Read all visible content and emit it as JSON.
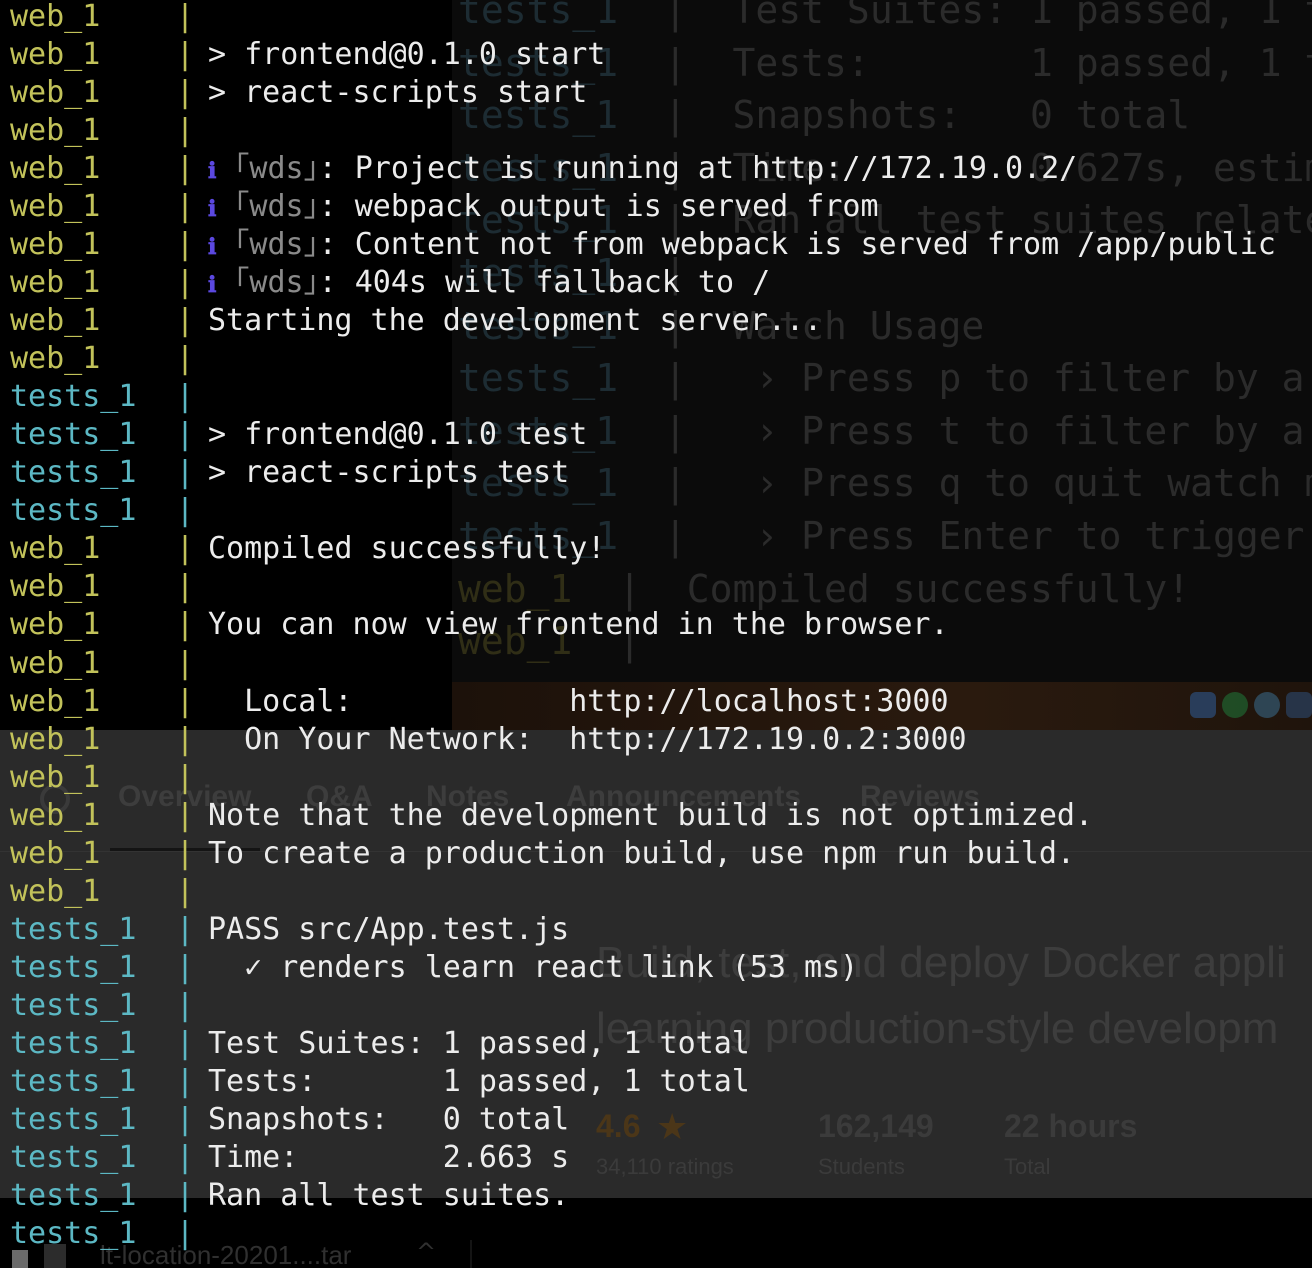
{
  "background_terminal": {
    "lines": [
      {
        "prefix": "tests_1",
        "text": "Test Suites: 1 passed, 1 t"
      },
      {
        "prefix": "tests_1",
        "text": "Tests:       1 passed, 1 t"
      },
      {
        "prefix": "tests_1",
        "text": "Snapshots:   0 total"
      },
      {
        "prefix": "tests_1",
        "text": "Time:        0.627s, estim"
      },
      {
        "prefix": "tests_1",
        "text": "Ran all test suites relate"
      },
      {
        "prefix": "tests_1",
        "text": ""
      },
      {
        "prefix": "tests_1",
        "text": "Watch Usage"
      },
      {
        "prefix": "tests_1",
        "text": " › Press p to filter by a"
      },
      {
        "prefix": "tests_1",
        "text": " › Press t to filter by a"
      },
      {
        "prefix": "tests_1",
        "text": " › Press q to quit watch m"
      },
      {
        "prefix": "tests_1",
        "text": " › Press Enter to trigger"
      },
      {
        "prefix": "web_1",
        "text": "Compiled successfully!"
      },
      {
        "prefix": "web_1",
        "text": ""
      }
    ]
  },
  "background_page": {
    "tabs": [
      "Overview",
      "Q&A",
      "Notes",
      "Announcements",
      "Reviews"
    ],
    "headline": "Build, test, and deploy Docker appli\nlearning production-style developm",
    "rating": {
      "value": "4.6",
      "label": "34,110 ratings"
    },
    "students": {
      "value": "162,149",
      "label": "Students"
    },
    "duration": {
      "value": "22 hours",
      "label": "Total"
    },
    "download_file": "lt-location-20201....tar"
  },
  "terminal": {
    "separator": "|",
    "info_icon": "ℹ",
    "bracket_open": "｢",
    "bracket_close": "｣",
    "lines": [
      {
        "source": "web_1",
        "text": ""
      },
      {
        "source": "web_1",
        "text": "> frontend@0.1.0 start"
      },
      {
        "source": "web_1",
        "text": "> react-scripts start"
      },
      {
        "source": "web_1",
        "text": ""
      },
      {
        "source": "web_1",
        "wds": true,
        "text": ": Project is running at http://172.19.0.2/"
      },
      {
        "source": "web_1",
        "wds": true,
        "text": ": webpack output is served from"
      },
      {
        "source": "web_1",
        "wds": true,
        "text": ": Content not from webpack is served from /app/public"
      },
      {
        "source": "web_1",
        "wds": true,
        "text": ": 404s will fallback to /"
      },
      {
        "source": "web_1",
        "text": "Starting the development server..."
      },
      {
        "source": "web_1",
        "text": ""
      },
      {
        "source": "tests_1",
        "text": ""
      },
      {
        "source": "tests_1",
        "text": "> frontend@0.1.0 test"
      },
      {
        "source": "tests_1",
        "text": "> react-scripts test"
      },
      {
        "source": "tests_1",
        "text": ""
      },
      {
        "source": "web_1",
        "text": "Compiled successfully!"
      },
      {
        "source": "web_1",
        "text": ""
      },
      {
        "source": "web_1",
        "text": "You can now view frontend in the browser."
      },
      {
        "source": "web_1",
        "text": ""
      },
      {
        "source": "web_1",
        "text": "  Local:            http://localhost:3000"
      },
      {
        "source": "web_1",
        "text": "  On Your Network:  http://172.19.0.2:3000"
      },
      {
        "source": "web_1",
        "text": ""
      },
      {
        "source": "web_1",
        "text": "Note that the development build is not optimized."
      },
      {
        "source": "web_1",
        "text": "To create a production build, use npm run build."
      },
      {
        "source": "web_1",
        "text": ""
      },
      {
        "source": "tests_1",
        "text": "PASS src/App.test.js"
      },
      {
        "source": "tests_1",
        "text": "  ✓ renders learn react link (53 ms)"
      },
      {
        "source": "tests_1",
        "text": ""
      },
      {
        "source": "tests_1",
        "text": "Test Suites: 1 passed, 1 total"
      },
      {
        "source": "tests_1",
        "text": "Tests:       1 passed, 1 total"
      },
      {
        "source": "tests_1",
        "text": "Snapshots:   0 total"
      },
      {
        "source": "tests_1",
        "text": "Time:        2.663 s"
      },
      {
        "source": "tests_1",
        "text": "Ran all test suites."
      },
      {
        "source": "tests_1",
        "text": ""
      }
    ]
  }
}
